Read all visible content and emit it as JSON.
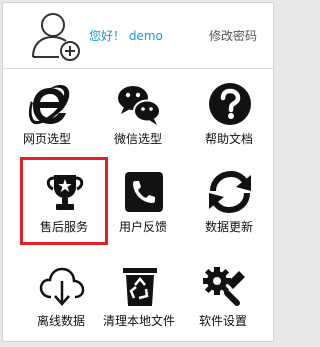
{
  "header": {
    "greeting": "您好！ demo",
    "change_password": "修改密码"
  },
  "tiles": [
    {
      "label": "网页选型",
      "icon": "ie-browser-icon",
      "selected": false
    },
    {
      "label": "微信选型",
      "icon": "wechat-icon",
      "selected": false
    },
    {
      "label": "帮助文档",
      "icon": "help-icon",
      "selected": false
    },
    {
      "label": "售后服务",
      "icon": "trophy-icon",
      "selected": true
    },
    {
      "label": "用户反馈",
      "icon": "phone-icon",
      "selected": false
    },
    {
      "label": "数据更新",
      "icon": "sync-icon",
      "selected": false
    },
    {
      "label": "离线数据",
      "icon": "cloud-download-icon",
      "selected": false
    },
    {
      "label": "清理本地文件",
      "icon": "recycle-bin-icon",
      "selected": false
    },
    {
      "label": "软件设置",
      "icon": "settings-tools-icon",
      "selected": false
    }
  ],
  "colors": {
    "greeting": "#1a9ad6",
    "selection_border": "#e0212a",
    "icon": "#111111"
  }
}
